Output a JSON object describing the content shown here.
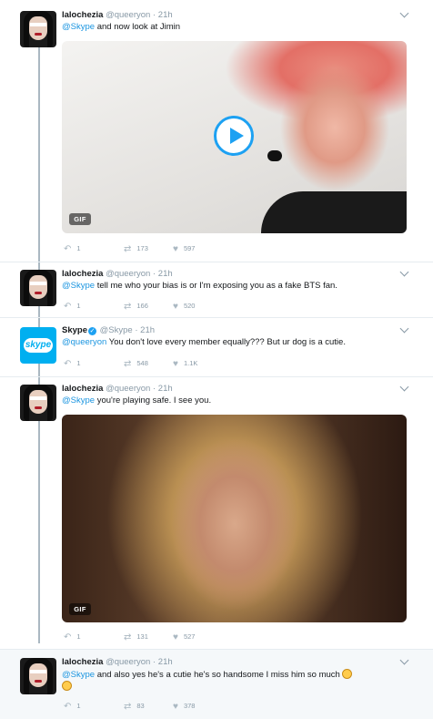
{
  "tweets": [
    {
      "name": "lalochezia",
      "handle": "@queeryon",
      "time": "21h",
      "mention": "@Skype",
      "text": " and now look at Jimin",
      "media_badge": "GIF",
      "reply_count": "1",
      "retweet_count": "173",
      "like_count": "597"
    },
    {
      "name": "lalochezia",
      "handle": "@queeryon",
      "time": "21h",
      "mention": "@Skype",
      "text": " tell me who your bias is or I'm exposing you as a fake BTS fan.",
      "reply_count": "1",
      "retweet_count": "166",
      "like_count": "520"
    },
    {
      "name": "Skype",
      "verified": true,
      "handle": "@Skype",
      "time": "21h",
      "mention": "@queeryon",
      "text": " You don't love every member equally??? But ur dog is a cutie.",
      "avatar_text": "skype",
      "reply_count": "1",
      "retweet_count": "548",
      "like_count": "1.1K"
    },
    {
      "name": "lalochezia",
      "handle": "@queeryon",
      "time": "21h",
      "mention": "@Skype",
      "text": " you're playing safe. I see you.",
      "media_badge": "GIF",
      "reply_count": "1",
      "retweet_count": "131",
      "like_count": "527"
    },
    {
      "name": "lalochezia",
      "handle": "@queeryon",
      "time": "21h",
      "mention": "@Skype",
      "text": " and also yes he's a cutie he's so handsome I miss him so much",
      "reply_count": "1",
      "retweet_count": "83",
      "like_count": "378"
    }
  ],
  "icons": {
    "reply": "reply-icon",
    "retweet": "retweet-icon",
    "like": "heart-icon",
    "more": "chevron-down-icon",
    "play": "play-icon"
  },
  "colors": {
    "link": "#1b95e0",
    "muted": "#8899a6",
    "thread_line": "#aab8c2",
    "highlight_bg": "#f5f8fa",
    "skype_blue": "#00aff0"
  },
  "sep": "·"
}
